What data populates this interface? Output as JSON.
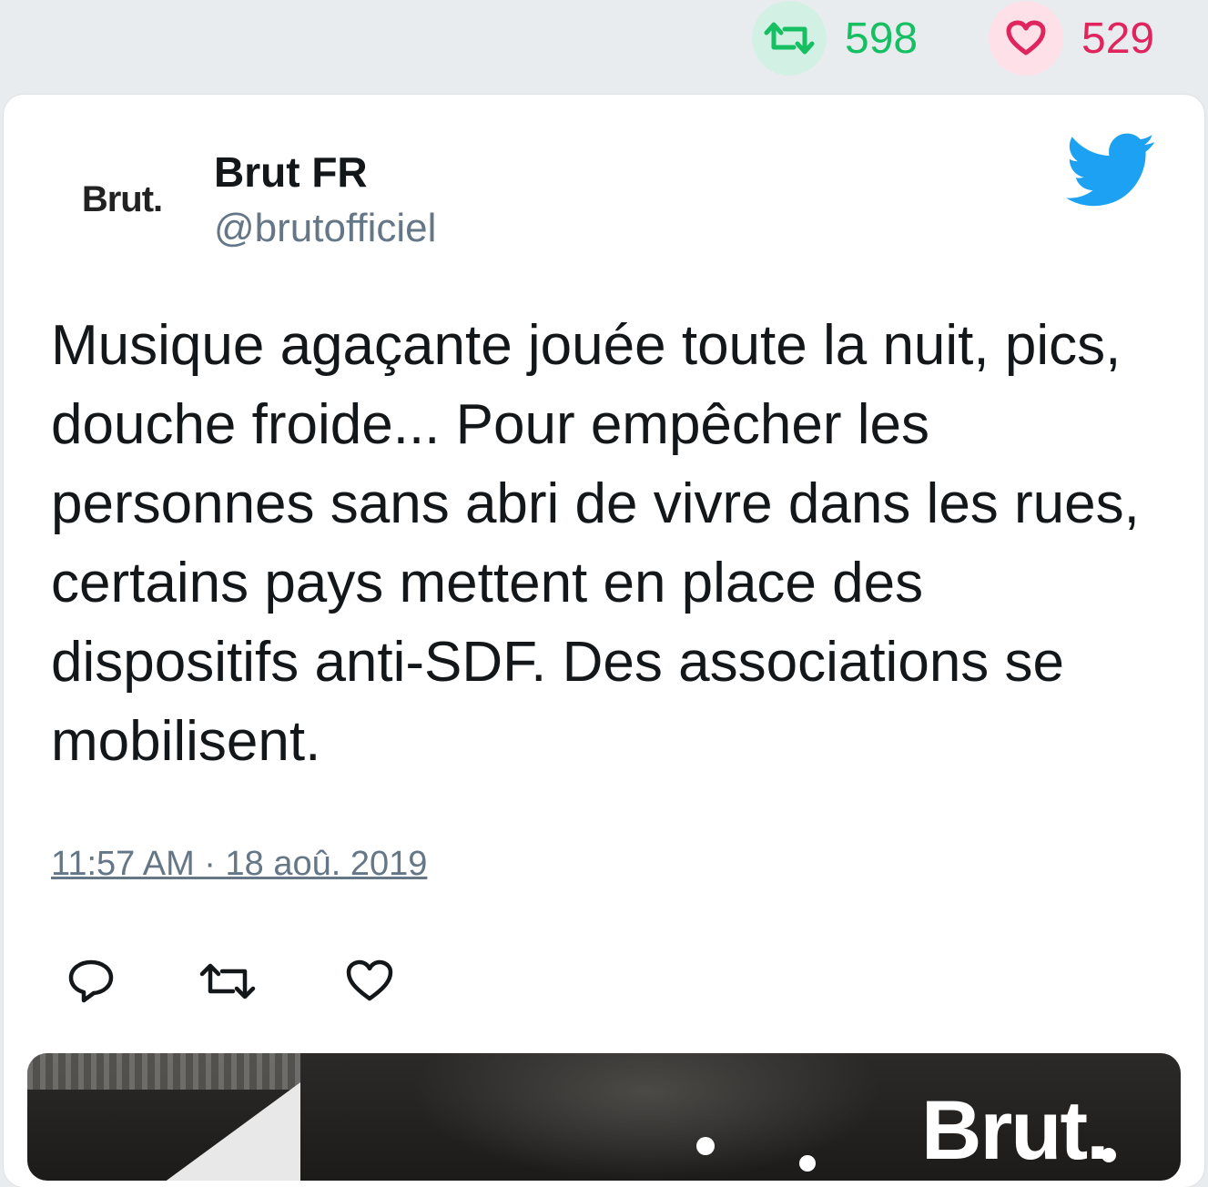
{
  "top_stats": {
    "retweets": "598",
    "likes": "529",
    "retweet_color": "#17bf63",
    "like_color": "#e0245e"
  },
  "tweet": {
    "avatar_text": "Brut.",
    "author_name": "Brut FR",
    "author_handle": "@brutofficiel",
    "text": "Musique agaçante jouée toute la nuit, pics, douche froide... Pour empêcher les personnes sans abri de vivre dans les rues, certains pays mettent en place des dispositifs anti-SDF. Des associations se mobilisent.",
    "timestamp": "11:57 AM · 18 aoû. 2019",
    "icons": [
      "twitter-bird-icon",
      "reply-icon",
      "retweet-icon",
      "like-icon"
    ]
  },
  "media": {
    "brand_text": "Brut."
  }
}
